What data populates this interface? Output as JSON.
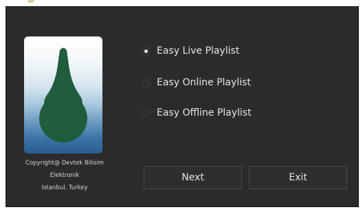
{
  "options": [
    {
      "label": "Easy Live Playlist",
      "checked": true
    },
    {
      "label": "Easy Online Playlist",
      "checked": false
    },
    {
      "label": "Easy Offline Playlist",
      "checked": false
    }
  ],
  "copyright": {
    "line1": "Copyright@ Devtek Bilisim",
    "line2": "Elektronik",
    "line3": "Istanbul, Turkey"
  },
  "buttons": {
    "next_label": "Next",
    "exit_label": "Exit"
  },
  "colors": {
    "background": "#2b2b2b",
    "text": "#e6e6e6",
    "logo_green": "#1f5d3c"
  },
  "icons": {
    "logo": "devtek-logo-icon"
  }
}
